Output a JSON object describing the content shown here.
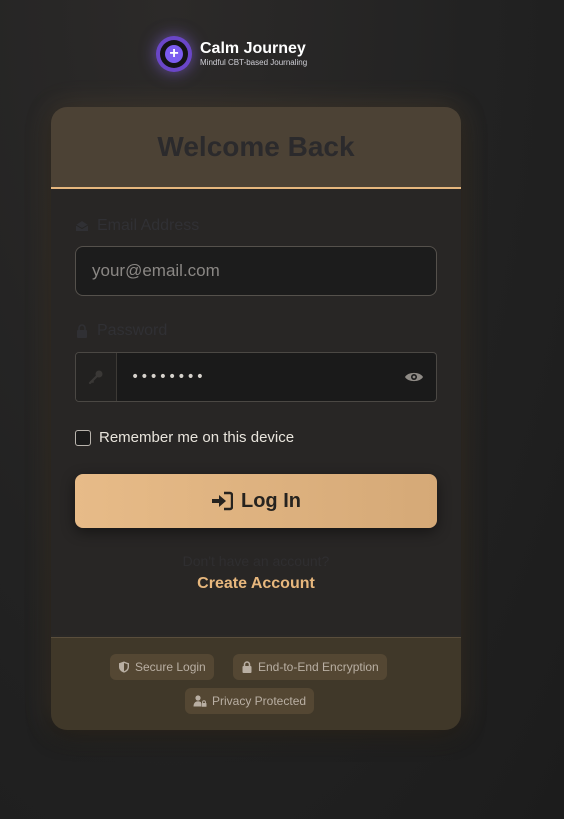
{
  "brand": {
    "name": "Calm Journey",
    "tagline": "Mindful CBT-based Journaling",
    "logo_icon": "plus-circle-icon",
    "accent_color": "#7b5cf0"
  },
  "card": {
    "title": "Welcome Back"
  },
  "form": {
    "email_label": "Email Address",
    "email_placeholder": "your@email.com",
    "email_value": "",
    "password_label": "Password",
    "password_value": "••••••••",
    "remember_label": "Remember me on this device",
    "remember_checked": false,
    "login_label": "Log In",
    "no_account_text": "Don't have an account?",
    "create_account_label": "Create Account"
  },
  "badges": [
    {
      "label": "Secure Login",
      "icon": "shield-icon"
    },
    {
      "label": "End-to-End Encryption",
      "icon": "lock-icon"
    },
    {
      "label": "Privacy Protected",
      "icon": "user-lock-icon"
    }
  ],
  "colors": {
    "button_gradient_start": "#e7bb88",
    "button_gradient_end": "#d5a977",
    "link_color": "#e7b77d",
    "header_divider": "#e6b77e"
  }
}
